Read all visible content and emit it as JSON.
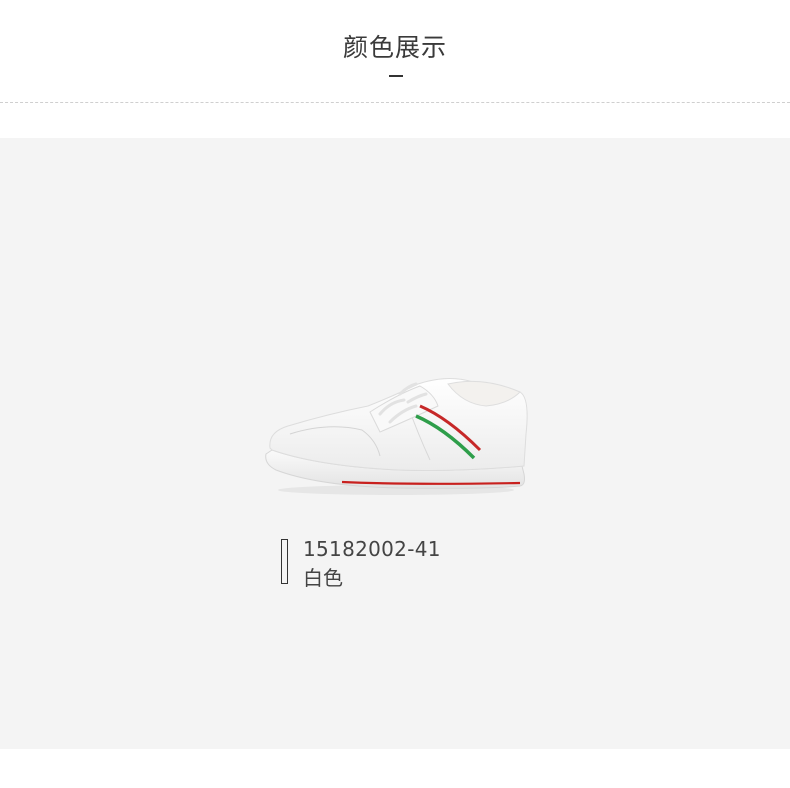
{
  "header": {
    "title": "颜色展示"
  },
  "showcase": {
    "panel_color": "#f4f4f4",
    "product": {
      "image_label": "white-sneaker-red-green-stripes",
      "code": "15182002-41",
      "color_name": "白色"
    }
  },
  "colors": {
    "title_text": "#3a3a3a",
    "stripe_red": "#c62828",
    "stripe_green": "#2e9e4a",
    "sole_red": "#c8201e"
  }
}
